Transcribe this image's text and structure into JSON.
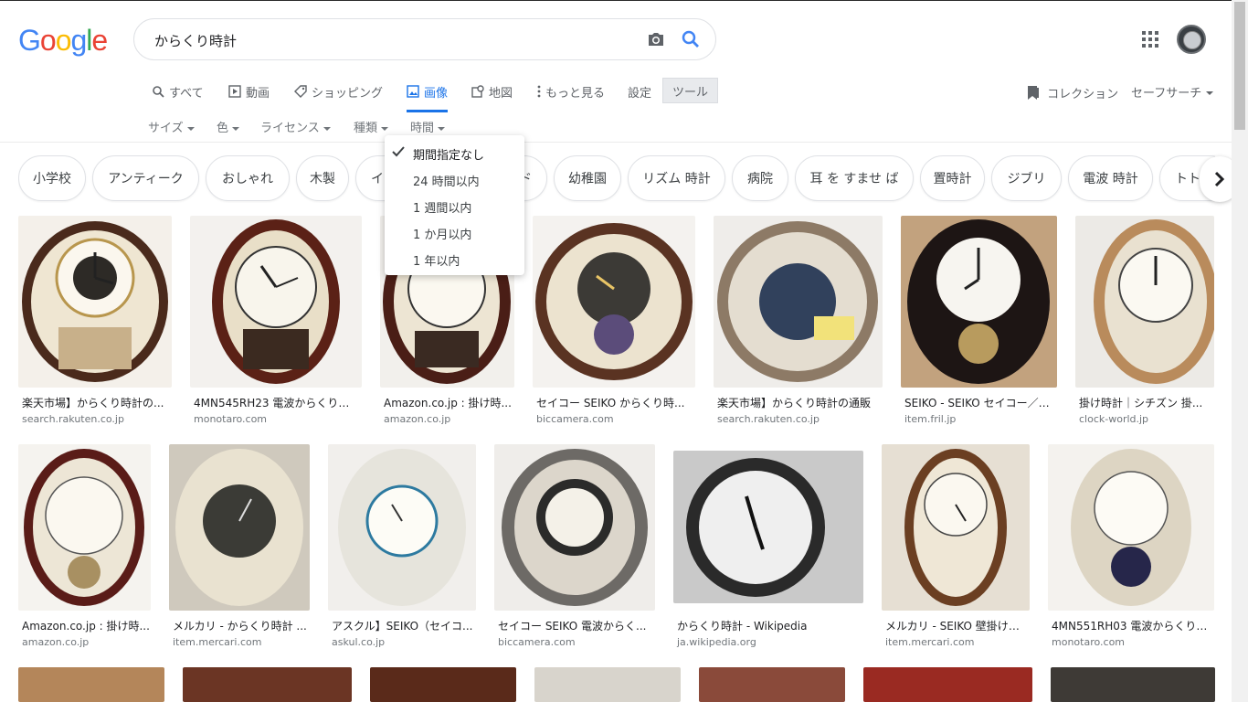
{
  "logo": {
    "letters": [
      "G",
      "o",
      "o",
      "g",
      "l",
      "e"
    ]
  },
  "search": {
    "query": "からくり時計"
  },
  "tabs": [
    {
      "label": "すべて",
      "icon": "search-icon"
    },
    {
      "label": "動画",
      "icon": "video-icon"
    },
    {
      "label": "ショッピング",
      "icon": "tag-icon"
    },
    {
      "label": "画像",
      "icon": "image-icon"
    },
    {
      "label": "地図",
      "icon": "map-icon"
    },
    {
      "label": "もっと見る",
      "icon": "more-vert-icon"
    },
    {
      "label": "設定"
    },
    {
      "label": "ツール"
    }
  ],
  "right_links": {
    "collections": "コレクション",
    "safesearch": "セーフサーチ"
  },
  "filters": [
    "サイズ",
    "色",
    "ライセンス",
    "種類",
    "時間"
  ],
  "time_menu": {
    "items": [
      "期間指定なし",
      "24 時間以内",
      "1 週間以内",
      "1 か月以内",
      "1 年以内"
    ],
    "selected": 0
  },
  "chips": [
    "小学校",
    "アンティーク",
    "おしゃれ",
    "木製",
    "イ",
    "ド",
    "幼稚園",
    "リズム 時計",
    "病院",
    "耳 を すませ ば",
    "置時計",
    "ジブリ",
    "電波 時計",
    "トト"
  ],
  "results": [
    {
      "caption": "楽天市場】からくり時計の...",
      "source": "search.rakuten.co.jp"
    },
    {
      "caption": "4MN545RH23 電波からくり時...",
      "source": "monotaro.com"
    },
    {
      "caption": "Amazon.co.jp : 掛け時...",
      "source": "amazon.co.jp"
    },
    {
      "caption": "セイコー SEIKO からくり時...",
      "source": "biccamera.com"
    },
    {
      "caption": "楽天市場】からくり時計の通販",
      "source": "search.rakuten.co.jp"
    },
    {
      "caption": "SEIKO - SEIKO セイコー／か...",
      "source": "item.fril.jp"
    },
    {
      "caption": "掛け時計｜シチズン 掛...",
      "source": "clock-world.jp"
    },
    {
      "caption": "Amazon.co.jp : 掛け時...",
      "source": "amazon.co.jp"
    },
    {
      "caption": "メルカリ - からくり時計 ...",
      "source": "item.mercari.com"
    },
    {
      "caption": "アスクル】SEIKO（セイコ...",
      "source": "askul.co.jp"
    },
    {
      "caption": "セイコー SEIKO 電波からく...",
      "source": "biccamera.com"
    },
    {
      "caption": "からくり時計 - Wikipedia",
      "source": "ja.wikipedia.org"
    },
    {
      "caption": "メルカリ - SEIKO 壁掛け時...",
      "source": "item.mercari.com"
    },
    {
      "caption": "4MN551RH03 電波からくり時...",
      "source": "monotaro.com"
    }
  ],
  "colors": {
    "accent": "#1a73e8",
    "text": "#202124",
    "muted": "#70757a"
  }
}
